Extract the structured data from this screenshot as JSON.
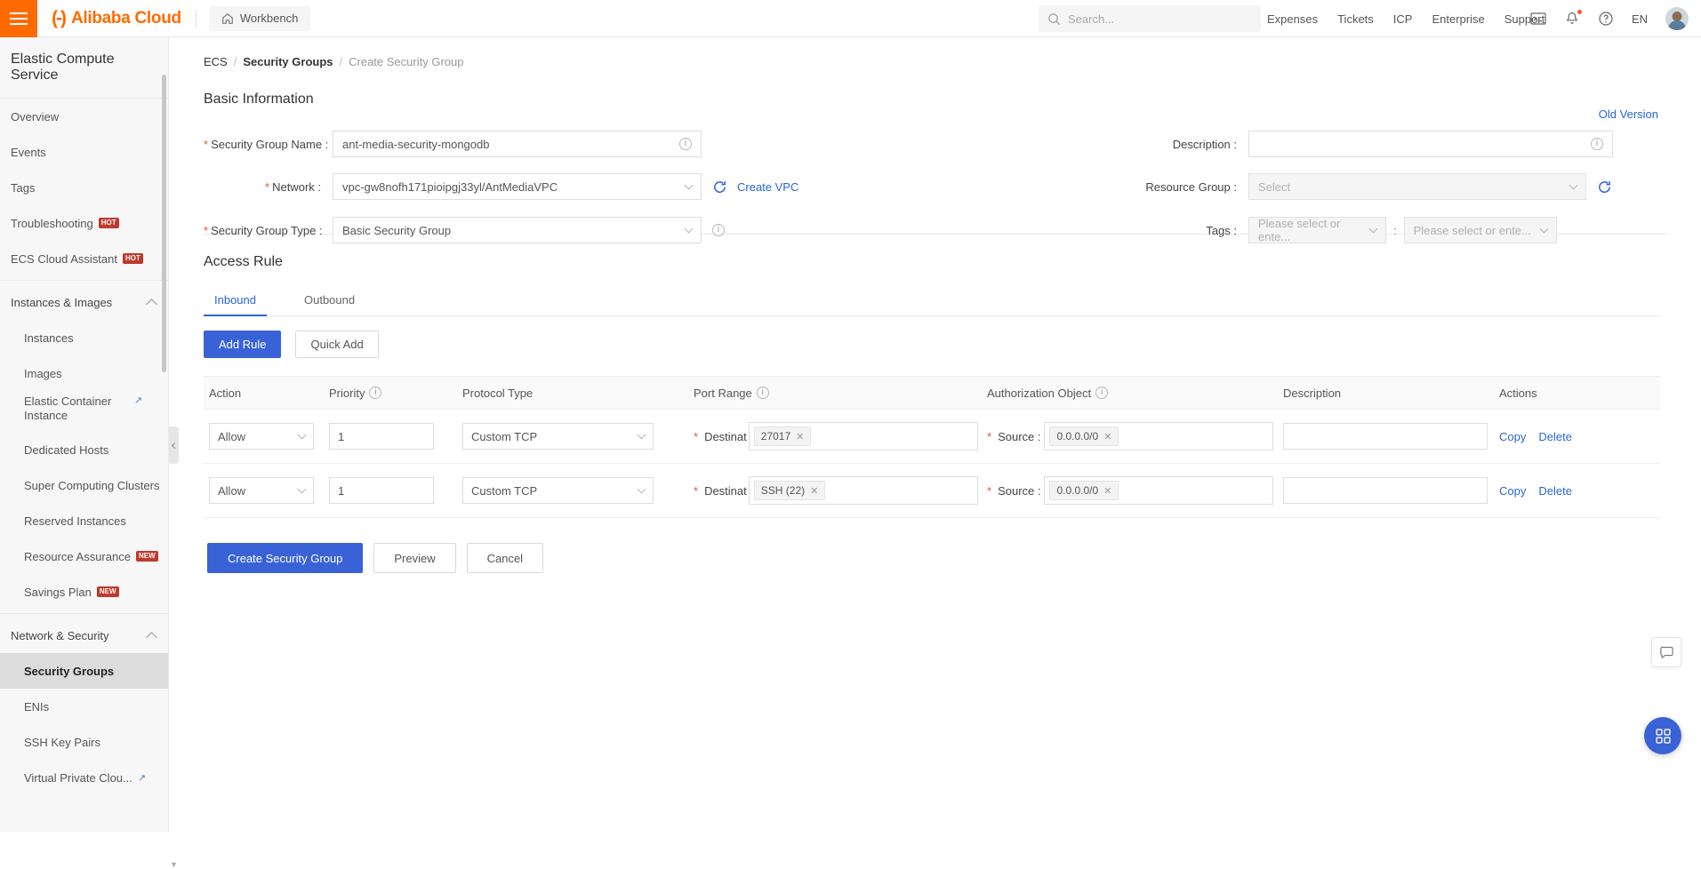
{
  "header": {
    "brand": "Alibaba Cloud",
    "workbench": "Workbench",
    "search_placeholder": "Search...",
    "links": [
      "Expenses",
      "Tickets",
      "ICP",
      "Enterprise",
      "Support"
    ],
    "language": "EN",
    "icons": [
      "terminal-icon",
      "bell-icon",
      "help-icon"
    ]
  },
  "sidebar": {
    "title": "Elastic Compute Service",
    "top_items": [
      {
        "label": "Overview",
        "badge": ""
      },
      {
        "label": "Events",
        "badge": ""
      },
      {
        "label": "Tags",
        "badge": ""
      },
      {
        "label": "Troubleshooting",
        "badge": "HOT"
      },
      {
        "label": "ECS Cloud Assistant",
        "badge": "HOT"
      }
    ],
    "group1": {
      "label": "Instances & Images",
      "items": [
        {
          "label": "Instances",
          "badge": "",
          "external": false
        },
        {
          "label": "Images",
          "badge": "",
          "external": false
        },
        {
          "label": "Elastic Container Instance",
          "badge": "",
          "external": true
        },
        {
          "label": "Dedicated Hosts",
          "badge": "",
          "external": false
        },
        {
          "label": "Super Computing Clusters",
          "badge": "",
          "external": false
        },
        {
          "label": "Reserved Instances",
          "badge": "",
          "external": false
        },
        {
          "label": "Resource Assurance",
          "badge": "NEW",
          "external": false
        },
        {
          "label": "Savings Plan",
          "badge": "NEW",
          "external": false
        }
      ]
    },
    "group2": {
      "label": "Network & Security",
      "items": [
        {
          "label": "Security Groups",
          "badge": "",
          "external": false,
          "active": true
        },
        {
          "label": "ENIs",
          "badge": "",
          "external": false,
          "active": false
        },
        {
          "label": "SSH Key Pairs",
          "badge": "",
          "external": false,
          "active": false
        },
        {
          "label": "Virtual Private Clou...",
          "badge": "",
          "external": true,
          "active": false
        }
      ]
    }
  },
  "breadcrumb": {
    "root": "ECS",
    "parent": "Security Groups",
    "current": "Create Security Group",
    "separator": "/"
  },
  "old_version_link": "Old Version",
  "basic_information": {
    "title": "Basic Information",
    "security_group_name": {
      "label": "Security Group Name :",
      "value": "ant-media-security-mongodb",
      "required": true
    },
    "network": {
      "label": "Network :",
      "value": "vpc-gw8nofh171pioipgj33yl/AntMediaVPC",
      "required": true,
      "create_link": "Create VPC"
    },
    "security_group_type": {
      "label": "Security Group Type :",
      "value": "Basic Security Group",
      "required": true
    },
    "description": {
      "label": "Description :",
      "value": "",
      "placeholder": ""
    },
    "resource_group": {
      "label": "Resource Group :",
      "value": "",
      "placeholder": "Select"
    },
    "tags": {
      "label": "Tags :",
      "key_placeholder": "Please select or ente...",
      "value_placeholder": "Please select or ente...",
      "separator": ":"
    }
  },
  "access_rule": {
    "title": "Access Rule",
    "tabs": [
      {
        "label": "Inbound",
        "active": true
      },
      {
        "label": "Outbound",
        "active": false
      }
    ],
    "buttons": {
      "add_rule": "Add Rule",
      "quick_add": "Quick Add"
    },
    "columns": [
      "Action",
      "Priority",
      "Protocol Type",
      "Port Range",
      "Authorization Object",
      "Description",
      "Actions"
    ],
    "rows": [
      {
        "action": "Allow",
        "priority": "1",
        "protocol": "Custom TCP",
        "port_label": "Destinat",
        "port_chip": "27017",
        "auth_label": "Source :",
        "auth_chip": "0.0.0.0/0",
        "description": "",
        "copy": "Copy",
        "delete": "Delete"
      },
      {
        "action": "Allow",
        "priority": "1",
        "protocol": "Custom TCP",
        "port_label": "Destinat",
        "port_chip": "SSH (22)",
        "auth_label": "Source :",
        "auth_chip": "0.0.0.0/0",
        "description": "",
        "copy": "Copy",
        "delete": "Delete"
      }
    ]
  },
  "footer_buttons": {
    "create": "Create Security Group",
    "preview": "Preview",
    "cancel": "Cancel"
  },
  "colors": {
    "brand_orange": "#ff6a00",
    "primary_blue": "#3a62d7",
    "link_blue": "#2a65d8",
    "required_red": "#e8503a",
    "badge_red": "#c0392b"
  }
}
